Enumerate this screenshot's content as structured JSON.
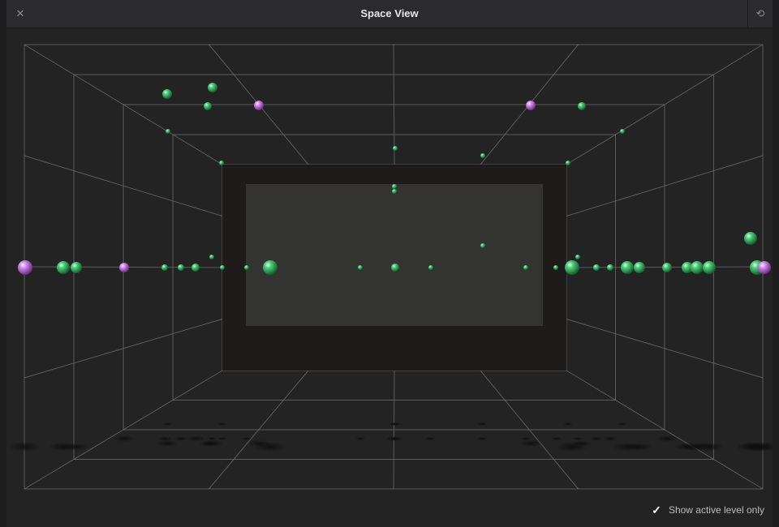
{
  "window": {
    "title": "Space View",
    "close_icon": "close-icon",
    "reset_icon": "reset-view-icon"
  },
  "option": {
    "label": "Show active level only",
    "checked": true,
    "check_icon": "checkmark-icon"
  },
  "colors": {
    "speaker_green": "#3fbf6a",
    "speaker_purple": "#c77be0",
    "grid": "#6e6e70",
    "screen": "#333332"
  }
}
